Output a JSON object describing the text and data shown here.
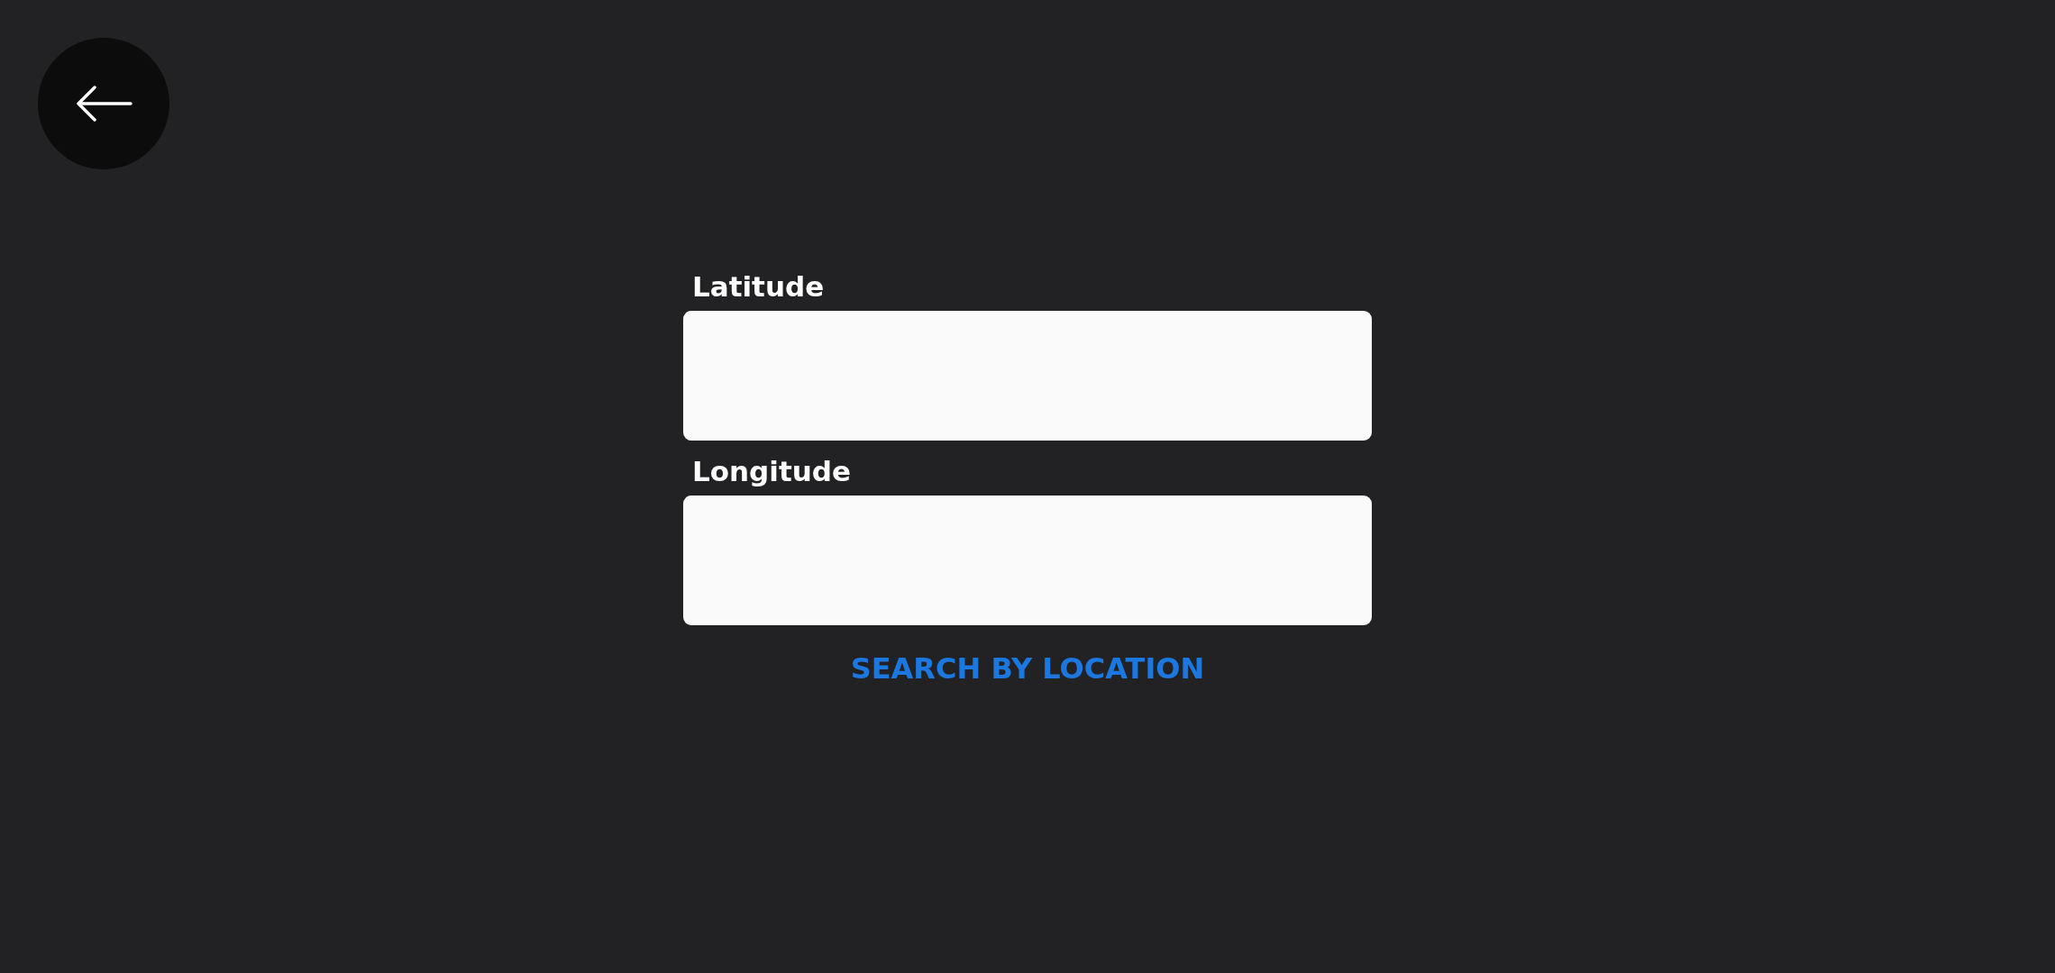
{
  "fields": [
    {
      "label": "Latitude"
    },
    {
      "label": "Longitude"
    }
  ],
  "search_link": "SEARCH BY LOCATION"
}
